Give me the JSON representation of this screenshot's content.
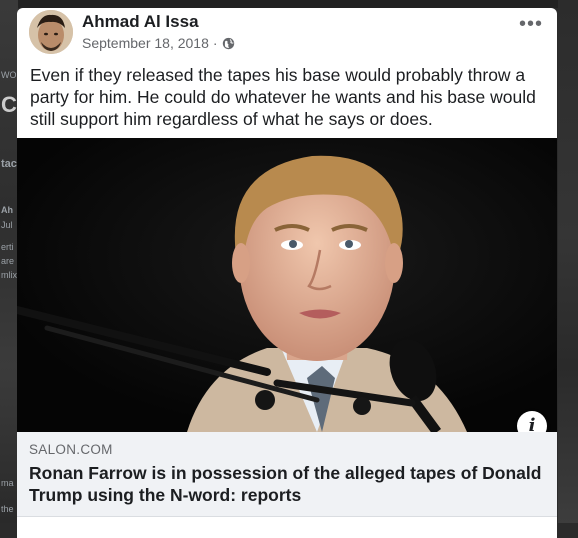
{
  "background": {
    "left_fragments": [
      "WO",
      "C",
      "tac",
      "Ah",
      "Jul",
      "erti",
      "are",
      "mlix",
      "ma",
      "the"
    ]
  },
  "post": {
    "author": "Ahmad Al Issa",
    "date": "September 18, 2018",
    "separator": "·",
    "privacy_icon": "globe-icon",
    "more_label": "•••",
    "text": "Even if they released the tapes his base would probably throw a party for him. He could do whatever he wants and his base would still support him regardless of what he says or does."
  },
  "link_preview": {
    "domain": "SALON.COM",
    "headline": "Ronan Farrow is in possession of the alleged tapes of Donald Trump using the N-word: reports",
    "info_label": "i"
  },
  "colors": {
    "text": "#1c1e21",
    "secondary": "#65676b",
    "link_bg": "#f0f2f5"
  }
}
